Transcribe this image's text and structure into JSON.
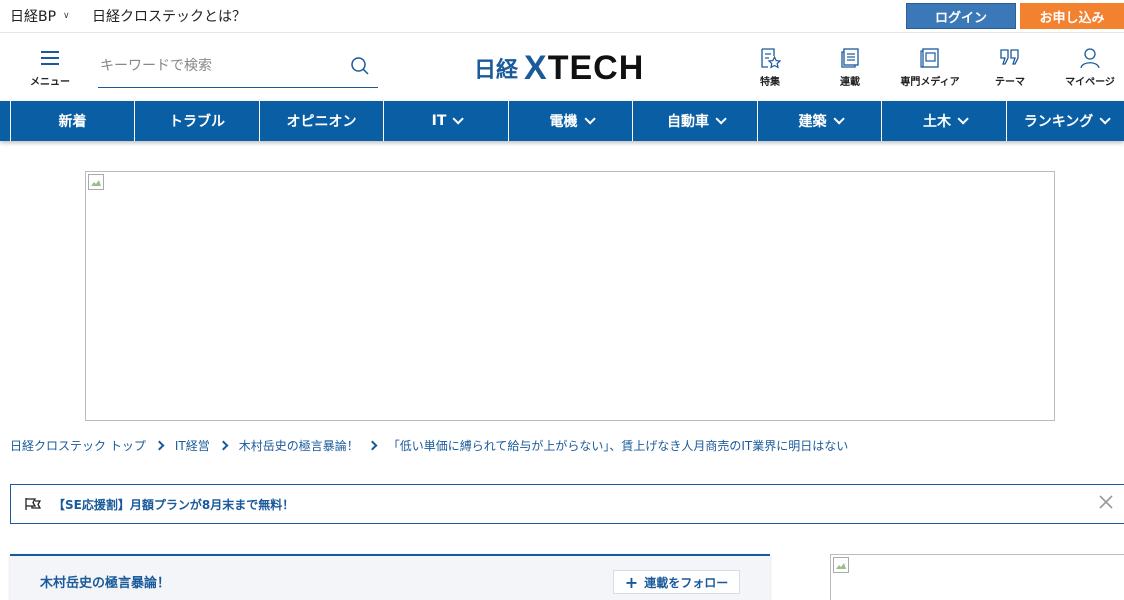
{
  "topbar": {
    "brand_label": "日経BP",
    "about_link": "日経クロステックとは？",
    "login_label": "ログイン",
    "signup_label": "お申し込み"
  },
  "header": {
    "menu_label": "メニュー",
    "search_placeholder": "キーワードで検索",
    "logo_prefix": "日経",
    "logo_x": "X",
    "logo_tech": "TECH",
    "nav": [
      {
        "label": "特集",
        "icon": "feature-star-icon"
      },
      {
        "label": "連載",
        "icon": "series-document-icon"
      },
      {
        "label": "専門メディア",
        "icon": "magazine-icon"
      },
      {
        "label": "テーマ",
        "icon": "quote-icon"
      },
      {
        "label": "マイページ",
        "icon": "user-icon"
      }
    ]
  },
  "categories": [
    {
      "label": "新着",
      "dropdown": false
    },
    {
      "label": "トラブル",
      "dropdown": false
    },
    {
      "label": "オピニオン",
      "dropdown": false
    },
    {
      "label": "IT",
      "dropdown": true
    },
    {
      "label": "電機",
      "dropdown": true
    },
    {
      "label": "自動車",
      "dropdown": true
    },
    {
      "label": "建築",
      "dropdown": true
    },
    {
      "label": "土木",
      "dropdown": true
    },
    {
      "label": "ランキング",
      "dropdown": true
    }
  ],
  "breadcrumb": [
    "日経クロステック トップ",
    "IT経営",
    "木村岳史の極言暴論！",
    "「低い単価に縛られて給与が上がらない」、賃上げなき人月商売のIT業界に明日はない"
  ],
  "banner": {
    "text": "【SE応援割】月額プランが8月末まで無料！"
  },
  "series": {
    "title": "木村岳史の極言暴論！",
    "follow_label": "連載をフォロー"
  },
  "colors": {
    "brand_blue": "#0a5ea3",
    "login_blue": "#3b78b8",
    "signup_orange": "#f28130"
  }
}
